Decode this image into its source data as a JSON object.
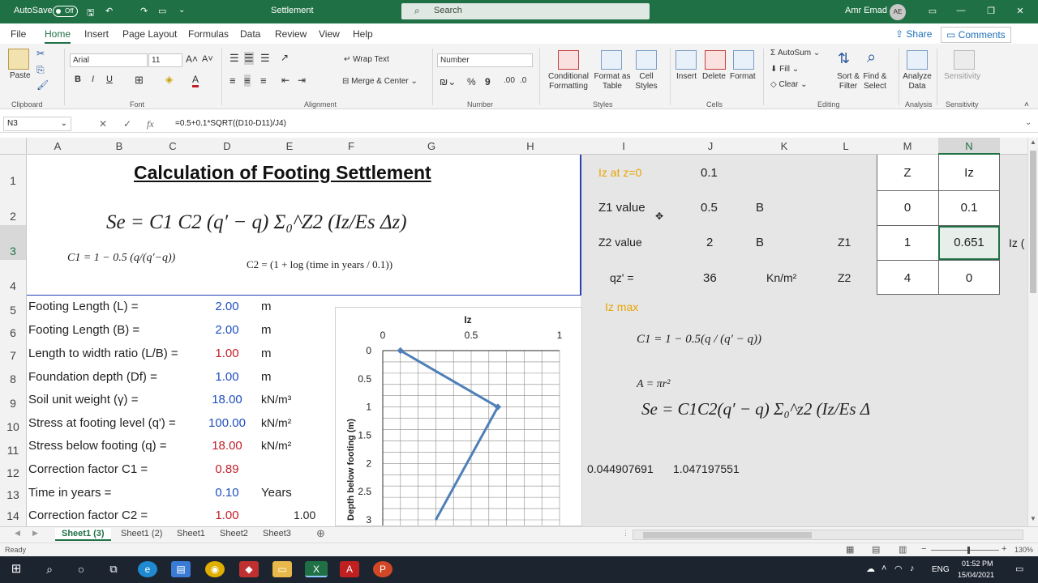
{
  "titlebar": {
    "autosave": "AutoSave",
    "toggle": "Off",
    "title": "Settlement",
    "search_placeholder": "Search",
    "user": "Amr Emad",
    "initials": "AE"
  },
  "menu": {
    "tabs": [
      "File",
      "Home",
      "Insert",
      "Page Layout",
      "Formulas",
      "Data",
      "Review",
      "View",
      "Help"
    ],
    "share": "Share",
    "comments": "Comments"
  },
  "ribbon": {
    "clipboard": {
      "paste": "Paste",
      "group": "Clipboard"
    },
    "font": {
      "name": "Arial",
      "size": "11",
      "group": "Font"
    },
    "alignment": {
      "wrap": "Wrap Text",
      "merge": "Merge & Center",
      "group": "Alignment"
    },
    "number": {
      "format": "Number",
      "group": "Number"
    },
    "styles": {
      "conditional": "Conditional Formatting",
      "format_table": "Format as Table",
      "cell_styles": "Cell Styles",
      "group": "Styles"
    },
    "cells": {
      "insert": "Insert",
      "delete": "Delete",
      "format": "Format",
      "group": "Cells"
    },
    "editing": {
      "autosum": "AutoSum",
      "fill": "Fill",
      "clear": "Clear",
      "sort": "Sort & Filter",
      "find": "Find & Select",
      "group": "Editing"
    },
    "analysis": {
      "analyze": "Analyze Data",
      "group": "Analysis"
    },
    "sensitivity": {
      "label": "Sensitivity",
      "group": "Sensitivity"
    }
  },
  "formula_bar": {
    "name_box": "N3",
    "formula": "=0.5+0.1*SQRT((D10-D11)/J4)"
  },
  "columns": [
    "A",
    "B",
    "C",
    "D",
    "E",
    "F",
    "G",
    "H",
    "I",
    "J",
    "K",
    "L",
    "M",
    "N"
  ],
  "rows": [
    "1",
    "2",
    "3",
    "4",
    "5",
    "6",
    "7",
    "8",
    "9",
    "10",
    "11",
    "12",
    "13",
    "14"
  ],
  "sheet": {
    "title": "Calculation of Footing Settlement",
    "eq_main": "Se = C1 C2 (q′ − q) Σ₀^Z2 (Iz/Es Δz)",
    "eq_c1": "C1 = 1 − 0.5 (q/(q′−q))",
    "eq_c2": "C2 = (1 + log (time in years / 0.1))",
    "labels": [
      "Footing Length (L) =",
      "Footing Length (B) =",
      "Length to width ratio (L/B) =",
      "Foundation depth (Df) =",
      "Soil unit weight (γ) =",
      "Stress at footing level (q') =",
      "Stress below footing (q) =",
      "Correction factor C1 =",
      "Time in years =",
      "Correction factor C2 ="
    ],
    "values": [
      "2.00",
      "2.00",
      "1.00",
      "1.00",
      "18.00",
      "100.00",
      "18.00",
      "0.89",
      "0.10",
      "1.00"
    ],
    "units": [
      "m",
      "m",
      "m",
      "m",
      "kN/m³",
      "kN/m²",
      "kN/m²",
      "",
      "Years",
      ""
    ],
    "e14": "1.00"
  },
  "side": {
    "i1": "Iz at z=0",
    "j1": "0.1",
    "i2": "Z1 value",
    "j2": "0.5",
    "k2": "B",
    "i3": "Z2 value",
    "j3": "2",
    "k3": "B",
    "l3": "Z1",
    "i4": "qz' =",
    "j4": "36",
    "k4": "Kn/m²",
    "l4": "Z2",
    "i5": "Iz max",
    "h12": "0.044907691",
    "j12": "1.047197551",
    "o3": "Iz (",
    "table": {
      "header": [
        "Z",
        "Iz"
      ],
      "rows": [
        [
          "0",
          "0.1"
        ],
        [
          "1",
          "0.651"
        ],
        [
          "4",
          "0"
        ]
      ]
    },
    "eq1": "C1 = 1 − 0.5(q / (q′ − q))",
    "eq2": "A = πr²",
    "eq3": "Se = C1C2(q′ − q) Σ₀^z2 (Iz/Es Δ"
  },
  "chart_data": {
    "type": "line",
    "title": "Iz",
    "xlabel": "Iz",
    "ylabel": "Depth below footing (m)",
    "xlim": [
      0,
      1
    ],
    "ylim": [
      0,
      3
    ],
    "x_ticks": [
      "0",
      "0.5",
      "1"
    ],
    "y_ticks": [
      "0",
      "0.5",
      "1",
      "1.5",
      "2",
      "2.5",
      "3"
    ],
    "series": [
      {
        "x": [
          0.1,
          0.651,
          0.3
        ],
        "y": [
          0,
          1,
          3
        ]
      }
    ],
    "grid": true,
    "line_color": "#4f7fb8"
  },
  "sheet_tabs": [
    "Sheet1 (3)",
    "Sheet1 (2)",
    "Sheet1",
    "Sheet2",
    "Sheet3"
  ],
  "status": {
    "ready": "Ready",
    "zoom": "130%"
  },
  "taskbar": {
    "lang": "ENG",
    "time": "01:52 PM",
    "date": "15/04/2021"
  },
  "colors": {
    "excel_green": "#1f7145",
    "value_blue": "#1f4fbf",
    "value_red": "#c0202a",
    "label_orange": "#e8a400"
  }
}
